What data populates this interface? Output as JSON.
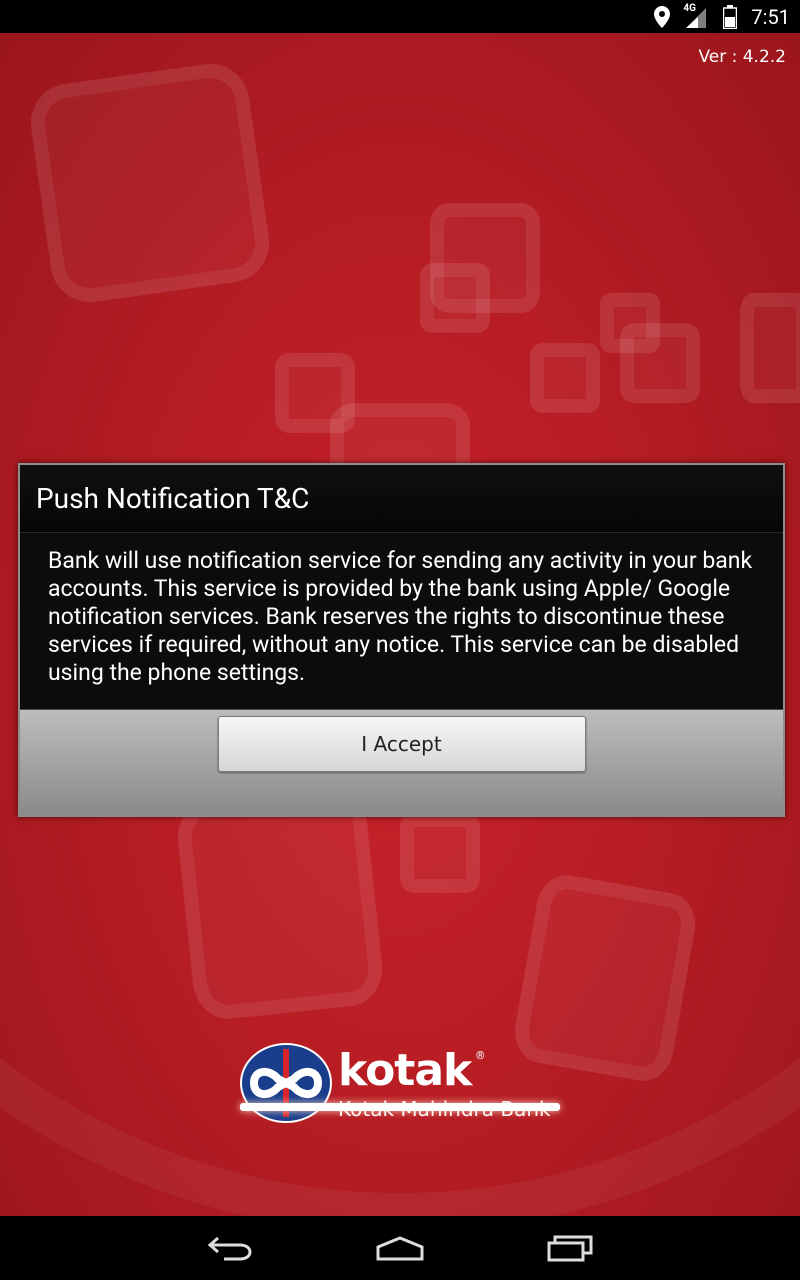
{
  "status_bar": {
    "network": "4G",
    "time": "7:51",
    "icons": [
      "location-icon",
      "signal-icon",
      "battery-icon"
    ]
  },
  "app": {
    "version": "Ver : 4.2.2"
  },
  "dialog": {
    "title": "Push Notification T&C",
    "body": "Bank will use notification service for sending any activity in your bank accounts. This service is provided by the bank using Apple/ Google notification services. Bank reserves the rights to discontinue these services if required, without any notice. This service can be disabled using the  phone settings.",
    "accept_label": "I Accept"
  },
  "logo": {
    "brand": "kotak",
    "registered": "®",
    "subtitle": "Kotak Mahindra Bank"
  },
  "loading": {
    "progress": 1.0
  },
  "nav": {
    "icons": [
      "back-icon",
      "home-icon",
      "recents-icon"
    ]
  },
  "colors": {
    "background": "#c8232b",
    "logo_blue": "#1a3e8c",
    "dialog_bg": "#000000"
  }
}
